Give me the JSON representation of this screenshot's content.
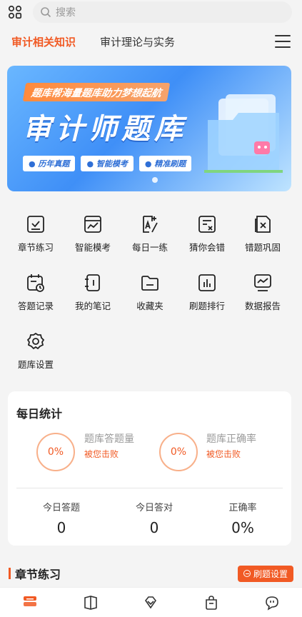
{
  "search": {
    "placeholder": "搜索"
  },
  "tabs": [
    {
      "label": "审计相关知识",
      "active": true
    },
    {
      "label": "审计理论与实务",
      "active": false
    }
  ],
  "banner": {
    "slogan": "题库帮海量题库助力梦想起航",
    "title": "审计师题库",
    "pills": [
      "● 历年真题",
      "● 智能模考",
      "● 精准刷题"
    ]
  },
  "features": [
    {
      "label": "章节练习",
      "icon": "checklist-icon"
    },
    {
      "label": "智能模考",
      "icon": "chart-window-icon"
    },
    {
      "label": "每日一练",
      "icon": "a-plus-pen-icon"
    },
    {
      "label": "猜你会错",
      "icon": "list-x-icon"
    },
    {
      "label": "错题巩固",
      "icon": "doc-x-icon"
    },
    {
      "label": "答题记录",
      "icon": "calendar-clock-icon"
    },
    {
      "label": "我的笔记",
      "icon": "notebook-icon"
    },
    {
      "label": "收藏夹",
      "icon": "folder-icon"
    },
    {
      "label": "刷题排行",
      "icon": "bar-chart-icon"
    },
    {
      "label": "数据报告",
      "icon": "monitor-chart-icon"
    },
    {
      "label": "题库设置",
      "icon": "gear-icon"
    }
  ],
  "stats": {
    "title": "每日统计",
    "rings": [
      {
        "value": "0%",
        "label": "题库答题量",
        "sub": "被您击败"
      },
      {
        "value": "0%",
        "label": "题库正确率",
        "sub": "被您击败"
      }
    ],
    "metrics": [
      {
        "label": "今日答题",
        "value": "0"
      },
      {
        "label": "今日答对",
        "value": "0"
      },
      {
        "label": "正确率",
        "value": "0%"
      }
    ]
  },
  "section": {
    "title": "章节练习",
    "button": "刷题设置"
  },
  "colors": {
    "accent": "#f15a24",
    "bannerBlue": "#3f8ff7"
  }
}
